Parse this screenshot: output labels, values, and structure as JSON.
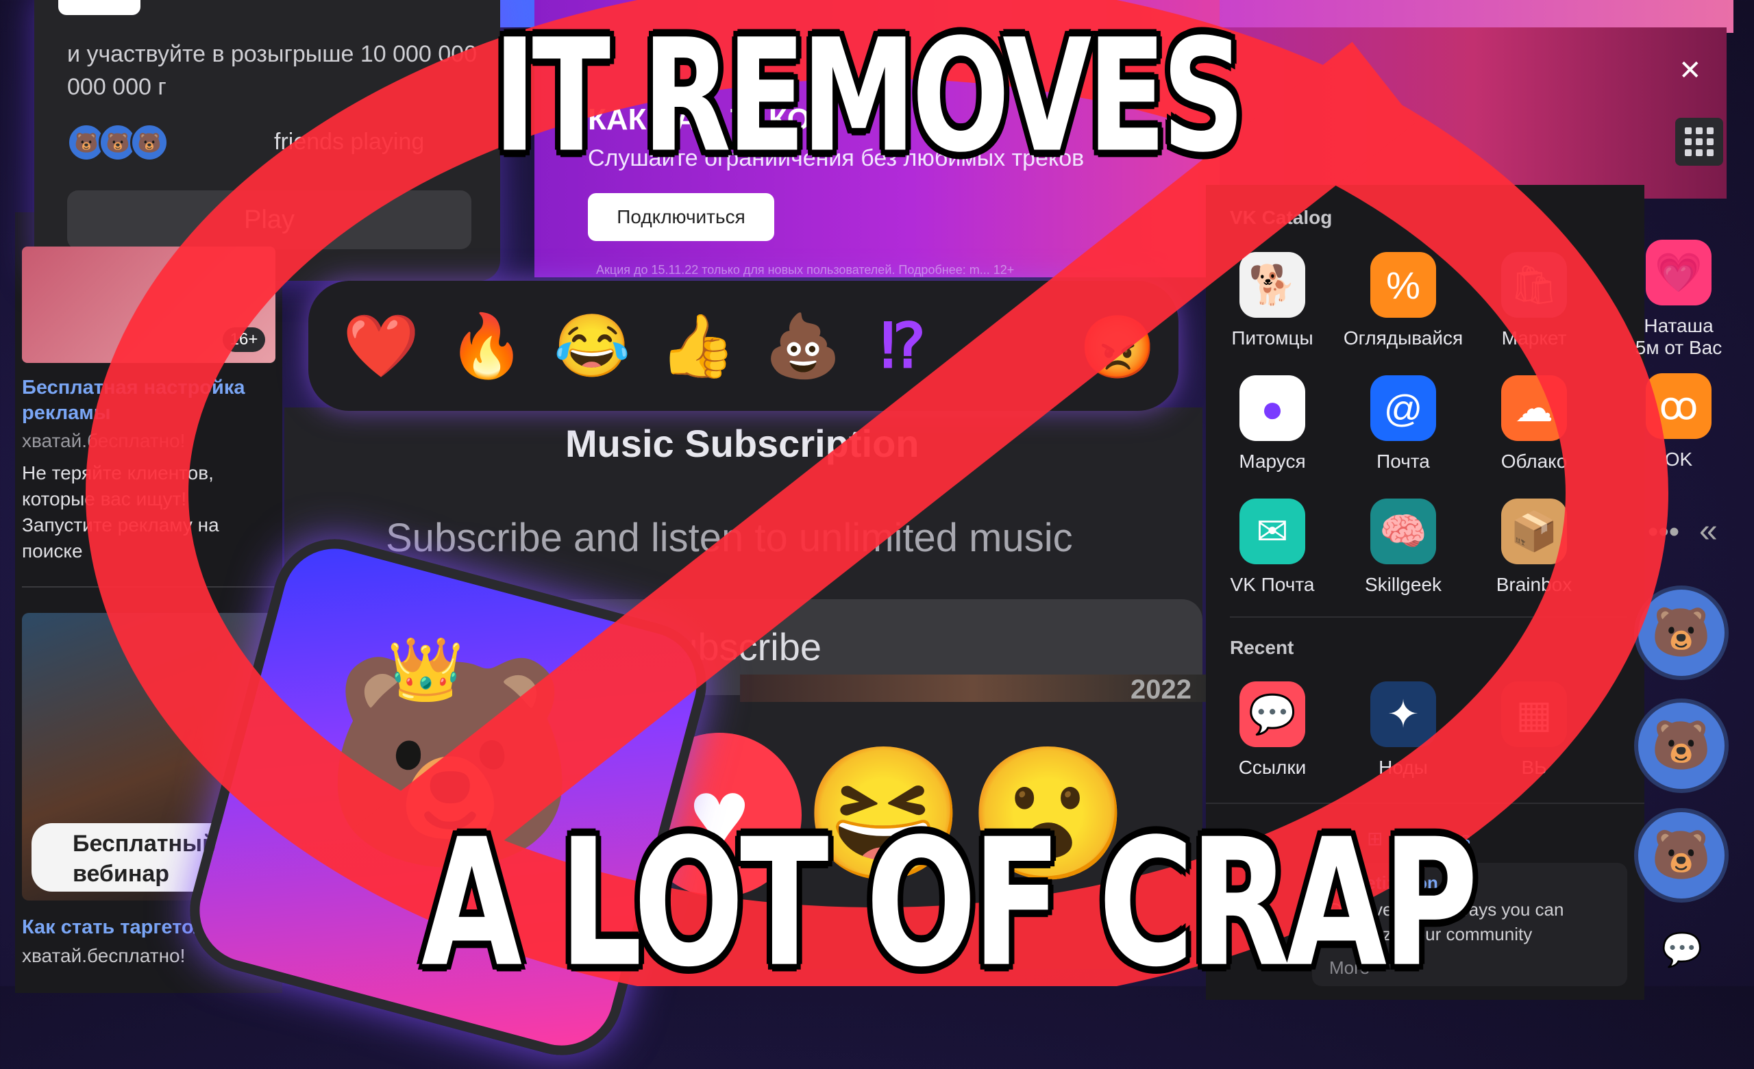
{
  "captions": {
    "top": "IT REMOVES",
    "bottom": "A LOT OF CRAP"
  },
  "game_widget": {
    "description": "и участвуйте в розыгрыше 10 000 000 000 000 г",
    "friends_text": "friends playing",
    "play_label": "Play"
  },
  "left_ad": {
    "age_badge": "16+",
    "title": "Бесплатная настройка рекламы",
    "site": "хватай.бесплатно!",
    "text": "Не теряйте клиентов, которые вас ищут! Запустите рекламу на поиске"
  },
  "left_ad2": {
    "pill": "Бесплатный вебинар",
    "title": "Как стать таргетол",
    "site": "хватай.бесплатно!"
  },
  "music_banner": {
    "promo_title": "КАК ВАМ ТАКОЕ",
    "subtitle": "Слушайте ограниичения без любимых треков",
    "connect_label": "Подключиться",
    "fineprint": "Акция до 15.11.22 только для новых пользователей. Подробнее: m... 12+"
  },
  "reactions": [
    "❤️",
    "🔥",
    "😂",
    "👍",
    "💩",
    "⁉"
  ],
  "angry_reaction": "😡",
  "music_card": {
    "title": "Music Subscription",
    "subtitle": "Subscribe and listen to unlimited music",
    "subscribe_label": "Subscribe",
    "year_label": "2022"
  },
  "catalog": {
    "title": "VK Catalog",
    "apps": [
      {
        "label": "Питомцы",
        "icon": "dog-icon",
        "glyph": "🐕",
        "color": "#f2f2f2"
      },
      {
        "label": "Оглядывайся",
        "icon": "percent-icon",
        "glyph": "%",
        "color": "#ff8a1a"
      },
      {
        "label": "Маркет",
        "icon": "bag-icon",
        "glyph": "🛍",
        "color": "#6a6aa8"
      },
      {
        "label": "Маруся",
        "icon": "marusia-icon",
        "glyph": "●",
        "color": "#ffffff"
      },
      {
        "label": "Почта",
        "icon": "at-icon",
        "glyph": "@",
        "color": "#1a6aff"
      },
      {
        "label": "Облако",
        "icon": "cloud-icon",
        "glyph": "☁",
        "color": "#ff6a2a"
      },
      {
        "label": "VK Почта",
        "icon": "envelope-icon",
        "glyph": "✉",
        "color": "#1ac8b0"
      },
      {
        "label": "Skillgeek",
        "icon": "skills-icon",
        "glyph": "🧠",
        "color": "#1a8a8a"
      },
      {
        "label": "Brainbox",
        "icon": "box-icon",
        "glyph": "📦",
        "color": "#d8a060"
      }
    ],
    "recent_title": "Recent",
    "recent": [
      {
        "label": "Ссылки",
        "icon": "link-bubble-icon",
        "glyph": "💬",
        "color": "#ff4a5a"
      },
      {
        "label": "Ноды",
        "icon": "nodes-icon",
        "glyph": "✦",
        "color": "#1a3a6a"
      },
      {
        "label": "ВЬ",
        "icon": "recent-app-icon",
        "glyph": "▦",
        "color": "#5a3a2a"
      }
    ],
    "mini_apps_label": "Mini apps",
    "monetization": {
      "title": "Monetization o",
      "text": "Discover all the ways you can monetize your community",
      "more": "More"
    }
  },
  "right_rail": {
    "item1_label": "Наташа 5м от Вас",
    "item1_glyph": "💗",
    "item2_label": "OK",
    "item2_glyph": "ꝏ"
  },
  "colors": {
    "no_sign": "#ff2d3a",
    "link_blue": "#7aa6f5",
    "banner_purple": "#b22bd8"
  }
}
